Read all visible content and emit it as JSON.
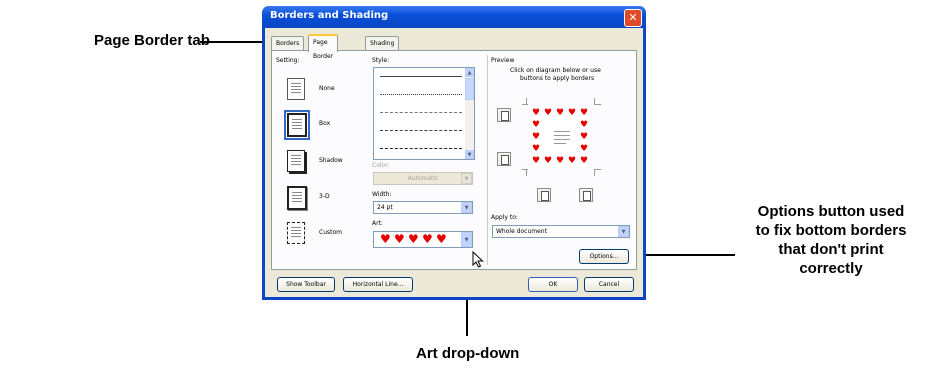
{
  "annotations": {
    "page_border_tab": "Page Border tab",
    "options_line1": "Options button used",
    "options_line2": "to fix bottom borders",
    "options_line3": "that don't print",
    "options_line4": "correctly",
    "art_dropdown": "Art drop-down"
  },
  "dialog": {
    "title": "Borders and Shading",
    "close_glyph": "✕",
    "tabs": [
      "Borders",
      "Page Border",
      "Shading"
    ],
    "active_tab": "Page Border",
    "setting": {
      "label": "Setting:",
      "options": [
        "None",
        "Box",
        "Shadow",
        "3-D",
        "Custom"
      ],
      "selected": "Box"
    },
    "style": {
      "label": "Style:"
    },
    "color": {
      "label": "Color:",
      "value": "Automatic"
    },
    "width": {
      "label": "Width:",
      "value": "24 pt"
    },
    "art": {
      "label": "Art:"
    },
    "preview": {
      "label": "Preview",
      "hint_line1": "Click on diagram below or use",
      "hint_line2": "buttons to apply borders"
    },
    "apply_to": {
      "label": "Apply to:",
      "value": "Whole document"
    },
    "buttons": {
      "options": "Options...",
      "show_toolbar": "Show Toolbar",
      "horizontal_line": "Horizontal Line...",
      "ok": "OK",
      "cancel": "Cancel"
    },
    "colors": {
      "title_bar": "#0a50d8",
      "dialog_face": "#ece9d8",
      "heart": "#e20000"
    }
  }
}
